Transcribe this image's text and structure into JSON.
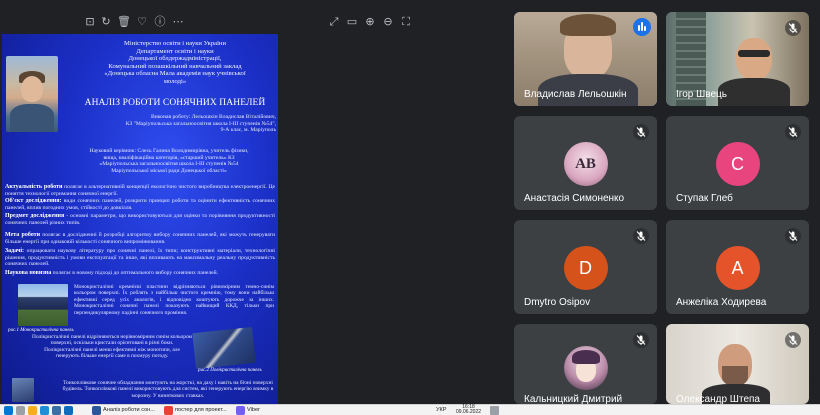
{
  "toolbar": {
    "left_icons": [
      "pin-icon",
      "rotate-icon",
      "delete-icon",
      "favorite-icon",
      "info-icon",
      "more-icon"
    ],
    "right_icons": [
      "expand-icon",
      "minimize-window-icon",
      "zoom-in-icon",
      "zoom-out-icon",
      "fullscreen-icon"
    ]
  },
  "poster": {
    "header_lines": [
      "Міністерство освіти і науки України",
      "Департамент освіти і науки",
      "Донецької облдержадміністрації,",
      "Комунальний позашкільний навчальний заклад",
      "«Донецька обласна Мала академія наук учнівської",
      "молоді»"
    ],
    "title": "АНАЛІЗ РОБОТИ СОНЯЧНИХ ПАНЕЛЕЙ",
    "author_lines": [
      "Виконав роботу: Лельошкін Владислав Віталійович,",
      "КЗ \"Маріупольська загальноосвітня школа І-ІІІ ступенів №54\",",
      "9-А клас, м. Маріуполь"
    ],
    "supervisor_lines": [
      "Науковий керівник: Слесь Галина Володимирівна, учитель фізики,",
      "вища, кваліфікаційна категорія, «старший учитель» КЗ",
      "«Маріупольська загальноосвітня школа І-ІІІ ступенів №54",
      "Маріупольської міської ради Донецької області»"
    ],
    "sections": [
      {
        "label": "Актуальність роботи",
        "text": "полягає в альтернативній концепції екологічно чистого виробництва електроенергії. Це поняття технології отримання сонячної енергії."
      },
      {
        "label": "Об'єкт дослідження:",
        "text": "види сонячних панелей, розкрити принцип роботи та оцінити ефективність сонячних панелей, вплив погодних умов, стійкості до довкілля."
      },
      {
        "label": "Предмет дослідження",
        "text": "- основні параметри, що використовуються для оцінки та порівняння продуктивності сонячних панелей різних типів."
      },
      {
        "label": "Мета роботи",
        "text": "полягає в дослідженні й розробці алгоритму вибору сонячних панелей, які можуть генерувати більше енергії при однаковій кількості сонячного випромінювання."
      },
      {
        "label": "Задачі:",
        "text": "опрацювати наукову літературу про сонячні панелі, їх типи; конструктивні матеріали, технологічні рішення, продуктивність і умови експлуатації та інше, які впливають на максимальну реальну продуктивність сонячних панелей."
      },
      {
        "label": "Наукова новизна",
        "text": "полягає в новому підході до оптимального вибору сонячних панелей."
      }
    ],
    "para_mono": "Монокристалічні кремнієві пластини відрізняються рівномірним темно-синім кольором поверхні. Їх роблять з найбільш чистого кремнію, тому вони найбільш ефективні серед усіх аналогів, і відповідно коштують дорожче за інших. Монокристалічні сонячні панелі показують найвищий ККД, тільки при перпендикулярному падінні сонячного проміння.",
    "caption_mono": "рис.1 Монокристалічна панель",
    "para_poly": "Полікристалічні панелі відрізняються нерівномірним синім кольором поверхні, оскільки кристали орієнтовані в різні боки. Полікристалічні панелі менш ефективні ніж монотипи, але генерують більше енергії саме в похмуру погоду.",
    "caption_poly": "рис.2 Полікристалічна панель",
    "para_thin": "Тонкоплівкове сонячне обладнання монтують на жорсткі, на даху і навіть на бічні поверхні будівель. Тонкоплівкові панелі використовують для систем, які генерують енергію взимку в морозну. У виняткових ставках."
  },
  "participants": [
    {
      "name": "Владислав Лельошкін",
      "type": "video",
      "speaking": true,
      "muted": false
    },
    {
      "name": "Ігор Швець",
      "type": "video",
      "speaking": false,
      "muted": true
    },
    {
      "name": "Анастасія Симоненко",
      "type": "avatar-image",
      "initials": "AB",
      "muted": true
    },
    {
      "name": "Ступак Глеб",
      "type": "letter",
      "letter": "C",
      "color": "#e8457e",
      "muted": true
    },
    {
      "name": "Dmytro Osipov",
      "type": "letter",
      "letter": "D",
      "color": "#d6521b",
      "muted": true
    },
    {
      "name": "Анжеліка Ходирева",
      "type": "letter",
      "letter": "A",
      "color": "#e5532a",
      "muted": true
    },
    {
      "name": "Кальницкий Дмитрий",
      "type": "avatar-image",
      "muted": true
    },
    {
      "name": "Олександр Штепа",
      "type": "video",
      "speaking": false,
      "muted": true
    }
  ],
  "taskbar": {
    "apps": [
      {
        "label": "",
        "icon": "search-icon"
      },
      {
        "label": "",
        "icon": "file-explorer-icon"
      },
      {
        "label": "",
        "icon": "edge-icon"
      },
      {
        "label": "",
        "icon": "store-icon"
      },
      {
        "label": "",
        "icon": "mail-icon"
      },
      {
        "label": "Аналіз роботи сон...",
        "icon": "word-icon"
      },
      {
        "label": "постер для проект...",
        "icon": "chrome-icon"
      },
      {
        "label": "Viber",
        "icon": "viber-icon"
      }
    ],
    "language": "УКР",
    "time": "16:18",
    "date": "09.06.2022",
    "colors": {
      "accent": "#1a73e8",
      "poster_blue": "#1b2fc6",
      "background": "#202124"
    }
  }
}
